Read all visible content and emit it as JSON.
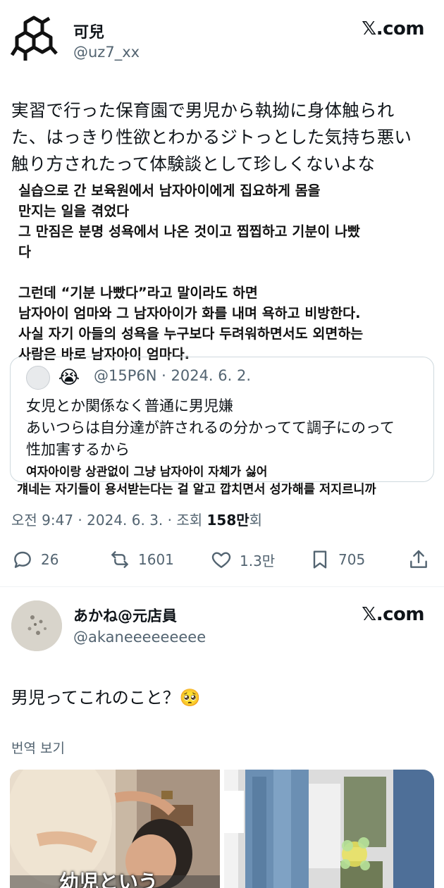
{
  "tweet1": {
    "name": "可兒",
    "handle": "@uz7_xx",
    "site_label": "𝕏.com",
    "text_lines": [
      "実習で行った保育園で男児から執拗に身体触られ",
      "た、はっきり性欲とわかるジトっとした気持ち悪い",
      "触り方されたって体験談として珍しくないよな"
    ],
    "translation_lines": [
      "실습으로 간 보육원에서 남자아이에게 집요하게 몸을",
      "만지는 일을 겪었다",
      "그 만짐은 분명 성욕에서 나온 것이고 찝찝하고 기분이 나빴",
      "다",
      "",
      "그런데 “기분 나빴다”라고 말이라도 하면",
      "남자아이 엄마와 그 남자아이가 화를 내며 욕하고 비방한다.",
      "사실 자기 아들의 성욕을 누구보다 두려워하면서도 외면하는",
      "사람은 바로 남자아이 엄마다."
    ],
    "quote": {
      "emoji": "😭",
      "meta": "@15P6N · 2024. 6. 2.",
      "text_lines": [
        "女児とか関係なく普通に男児嫌",
        "あいつらは自分達が許されるの分かってて調子にのって",
        "性加害するから"
      ],
      "translation_line1": "여자아이랑 상관없이 그냥 남자아이 자체가 싫어",
      "translation_line2": "걔네는 자기들이 용서받는다는 걸 알고 깝치면서 성가해를 저지르니까"
    },
    "timestamp_prefix": "오전 9:47 · 2024. 6. 3. · 조회 ",
    "views": "158만",
    "views_suffix": "회",
    "actions": {
      "replies": "26",
      "retweets": "1601",
      "likes": "1.3만",
      "bookmarks": "705"
    }
  },
  "tweet2": {
    "name": "あかね@元店員",
    "handle": "@akaneeeeeeeee",
    "site_label": "𝕏.com",
    "text": "男児ってこれのこと？🥺",
    "translate_label": "번역 보기",
    "media_caption": "幼児という"
  },
  "colors": {
    "text": "#0f1419",
    "secondary": "#536471",
    "border": "#cfd9de"
  }
}
